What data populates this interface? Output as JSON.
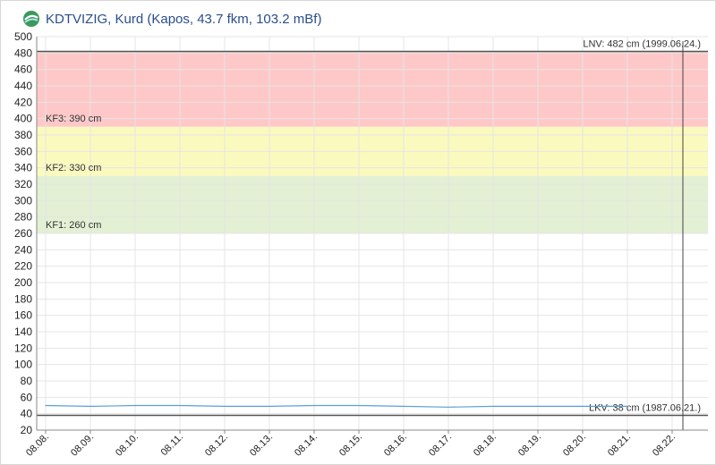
{
  "header": {
    "title": "KDTVIZIG, Kurd (Kapos, 43.7 fkm, 103.2 mBf)",
    "logo_icon": "kdtvizig-logo-icon"
  },
  "chart_data": {
    "type": "line",
    "title": "KDTVIZIG, Kurd (Kapos, 43.7 fkm, 103.2 mBf)",
    "xlabel": "",
    "ylabel": "",
    "ylim": [
      20,
      500
    ],
    "y_ticks": [
      20,
      40,
      60,
      80,
      100,
      120,
      140,
      160,
      180,
      200,
      220,
      240,
      260,
      280,
      300,
      320,
      340,
      360,
      380,
      400,
      420,
      440,
      460,
      480,
      500
    ],
    "x_ticks": [
      "08.08.",
      "08.09.",
      "08.10.",
      "08.11.",
      "08.12.",
      "08.13.",
      "08.14.",
      "08.15.",
      "08.16.",
      "08.17.",
      "08.18.",
      "08.19.",
      "08.20.",
      "08.21.",
      "08.22."
    ],
    "grid": true,
    "series": [
      {
        "color": "#5aa0d8",
        "x": [
          "08.08.",
          "08.09.",
          "08.10.",
          "08.11.",
          "08.12.",
          "08.13.",
          "08.14.",
          "08.15.",
          "08.16.",
          "08.17.",
          "08.18.",
          "08.19.",
          "08.20.",
          "08.21."
        ],
        "values": [
          50,
          49,
          50,
          50,
          49,
          49,
          50,
          50,
          49,
          48,
          49,
          49,
          49,
          49
        ]
      }
    ],
    "bands": [
      {
        "from": 390,
        "to": 482,
        "label": "KF3: 390 cm",
        "color": "#ffc8c8"
      },
      {
        "from": 330,
        "to": 390,
        "label": "KF2: 330 cm",
        "color": "#fafabe"
      },
      {
        "from": 260,
        "to": 330,
        "label": "KF1: 260 cm",
        "color": "#e3f0d4"
      }
    ],
    "reference_lines": [
      {
        "value": 482,
        "label": "LNV: 482 cm (1999.06.24.)",
        "color": "#555555"
      },
      {
        "value": 38,
        "label": "LKV: 38 cm (1987.06.21.)",
        "color": "#555555"
      }
    ],
    "vertical_marker": {
      "x": "08.22.",
      "color": "#444444"
    }
  }
}
